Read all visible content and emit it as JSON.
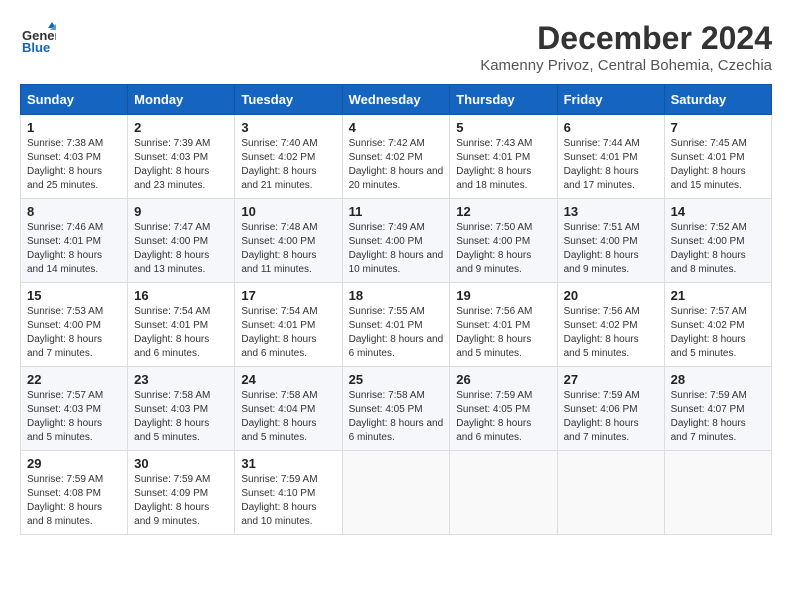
{
  "header": {
    "logo_general": "General",
    "logo_blue": "Blue",
    "month_title": "December 2024",
    "location": "Kamenny Privoz, Central Bohemia, Czechia"
  },
  "calendar": {
    "weekdays": [
      "Sunday",
      "Monday",
      "Tuesday",
      "Wednesday",
      "Thursday",
      "Friday",
      "Saturday"
    ],
    "weeks": [
      [
        {
          "day": "1",
          "sunrise": "7:38 AM",
          "sunset": "4:03 PM",
          "daylight": "8 hours and 25 minutes."
        },
        {
          "day": "2",
          "sunrise": "7:39 AM",
          "sunset": "4:03 PM",
          "daylight": "8 hours and 23 minutes."
        },
        {
          "day": "3",
          "sunrise": "7:40 AM",
          "sunset": "4:02 PM",
          "daylight": "8 hours and 21 minutes."
        },
        {
          "day": "4",
          "sunrise": "7:42 AM",
          "sunset": "4:02 PM",
          "daylight": "8 hours and 20 minutes."
        },
        {
          "day": "5",
          "sunrise": "7:43 AM",
          "sunset": "4:01 PM",
          "daylight": "8 hours and 18 minutes."
        },
        {
          "day": "6",
          "sunrise": "7:44 AM",
          "sunset": "4:01 PM",
          "daylight": "8 hours and 17 minutes."
        },
        {
          "day": "7",
          "sunrise": "7:45 AM",
          "sunset": "4:01 PM",
          "daylight": "8 hours and 15 minutes."
        }
      ],
      [
        {
          "day": "8",
          "sunrise": "7:46 AM",
          "sunset": "4:01 PM",
          "daylight": "8 hours and 14 minutes."
        },
        {
          "day": "9",
          "sunrise": "7:47 AM",
          "sunset": "4:00 PM",
          "daylight": "8 hours and 13 minutes."
        },
        {
          "day": "10",
          "sunrise": "7:48 AM",
          "sunset": "4:00 PM",
          "daylight": "8 hours and 11 minutes."
        },
        {
          "day": "11",
          "sunrise": "7:49 AM",
          "sunset": "4:00 PM",
          "daylight": "8 hours and 10 minutes."
        },
        {
          "day": "12",
          "sunrise": "7:50 AM",
          "sunset": "4:00 PM",
          "daylight": "8 hours and 9 minutes."
        },
        {
          "day": "13",
          "sunrise": "7:51 AM",
          "sunset": "4:00 PM",
          "daylight": "8 hours and 9 minutes."
        },
        {
          "day": "14",
          "sunrise": "7:52 AM",
          "sunset": "4:00 PM",
          "daylight": "8 hours and 8 minutes."
        }
      ],
      [
        {
          "day": "15",
          "sunrise": "7:53 AM",
          "sunset": "4:00 PM",
          "daylight": "8 hours and 7 minutes."
        },
        {
          "day": "16",
          "sunrise": "7:54 AM",
          "sunset": "4:01 PM",
          "daylight": "8 hours and 6 minutes."
        },
        {
          "day": "17",
          "sunrise": "7:54 AM",
          "sunset": "4:01 PM",
          "daylight": "8 hours and 6 minutes."
        },
        {
          "day": "18",
          "sunrise": "7:55 AM",
          "sunset": "4:01 PM",
          "daylight": "8 hours and 6 minutes."
        },
        {
          "day": "19",
          "sunrise": "7:56 AM",
          "sunset": "4:01 PM",
          "daylight": "8 hours and 5 minutes."
        },
        {
          "day": "20",
          "sunrise": "7:56 AM",
          "sunset": "4:02 PM",
          "daylight": "8 hours and 5 minutes."
        },
        {
          "day": "21",
          "sunrise": "7:57 AM",
          "sunset": "4:02 PM",
          "daylight": "8 hours and 5 minutes."
        }
      ],
      [
        {
          "day": "22",
          "sunrise": "7:57 AM",
          "sunset": "4:03 PM",
          "daylight": "8 hours and 5 minutes."
        },
        {
          "day": "23",
          "sunrise": "7:58 AM",
          "sunset": "4:03 PM",
          "daylight": "8 hours and 5 minutes."
        },
        {
          "day": "24",
          "sunrise": "7:58 AM",
          "sunset": "4:04 PM",
          "daylight": "8 hours and 5 minutes."
        },
        {
          "day": "25",
          "sunrise": "7:58 AM",
          "sunset": "4:05 PM",
          "daylight": "8 hours and 6 minutes."
        },
        {
          "day": "26",
          "sunrise": "7:59 AM",
          "sunset": "4:05 PM",
          "daylight": "8 hours and 6 minutes."
        },
        {
          "day": "27",
          "sunrise": "7:59 AM",
          "sunset": "4:06 PM",
          "daylight": "8 hours and 7 minutes."
        },
        {
          "day": "28",
          "sunrise": "7:59 AM",
          "sunset": "4:07 PM",
          "daylight": "8 hours and 7 minutes."
        }
      ],
      [
        {
          "day": "29",
          "sunrise": "7:59 AM",
          "sunset": "4:08 PM",
          "daylight": "8 hours and 8 minutes."
        },
        {
          "day": "30",
          "sunrise": "7:59 AM",
          "sunset": "4:09 PM",
          "daylight": "8 hours and 9 minutes."
        },
        {
          "day": "31",
          "sunrise": "7:59 AM",
          "sunset": "4:10 PM",
          "daylight": "8 hours and 10 minutes."
        },
        null,
        null,
        null,
        null
      ]
    ]
  }
}
